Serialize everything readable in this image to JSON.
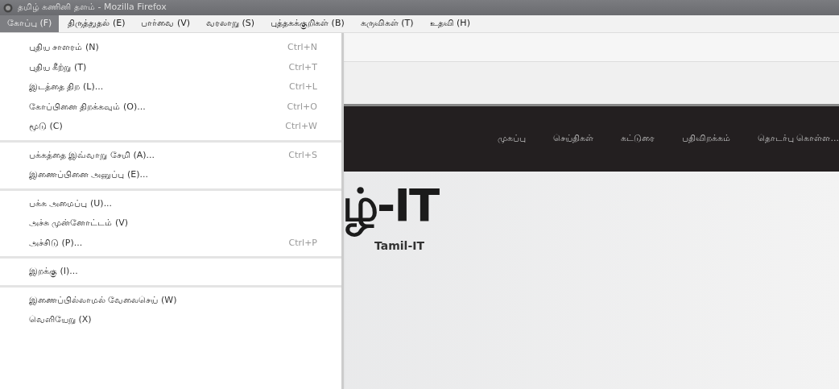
{
  "window": {
    "title": "தமிழ் கணினி தளம் - Mozilla Firefox"
  },
  "menu_bar": [
    {
      "label": "கோப்பு (F)",
      "selected": true
    },
    {
      "label": "திருத்துதல் (E)",
      "selected": false
    },
    {
      "label": "பார்வை (V)",
      "selected": false
    },
    {
      "label": "வரலாறு (S)",
      "selected": false
    },
    {
      "label": "புத்தகக்குறிகள் (B)",
      "selected": false
    },
    {
      "label": "கருவிகள் (T)",
      "selected": false
    },
    {
      "label": "உதவி (H)",
      "selected": false
    }
  ],
  "file_menu": {
    "groups": [
      [
        {
          "label": "புதிய சாளரம் (N)",
          "shortcut": "Ctrl+N"
        },
        {
          "label": "புதிய கீற்று (T)",
          "shortcut": "Ctrl+T"
        },
        {
          "label": "இடத்தை திற (L)...",
          "shortcut": "Ctrl+L"
        },
        {
          "label": "கோப்பினை திறக்கவும் (O)...",
          "shortcut": "Ctrl+O"
        },
        {
          "label": "மூடு (C)",
          "shortcut": "Ctrl+W"
        }
      ],
      [
        {
          "label": "பக்கத்தை இவ்வாறு சேமி (A)...",
          "shortcut": "Ctrl+S"
        },
        {
          "label": "இணைப்பினை அனுப்பு (E)..."
        }
      ],
      [
        {
          "label": "பக்க அமைப்பு (U)..."
        },
        {
          "label": "அச்சு முன்னோட்டம் (V)"
        },
        {
          "label": "அச்சிடு (P)...",
          "shortcut": "Ctrl+P"
        }
      ],
      [
        {
          "label": "இறக்கு (I)..."
        }
      ],
      [
        {
          "label": "இணைப்பில்லாமல் வேலைசெய் (W)"
        },
        {
          "label": "வெளியேறு (X)"
        }
      ]
    ]
  },
  "site": {
    "nav": [
      "முகப்பு",
      "செய்திகள்",
      "கட்டுரை",
      "பதிவிறக்கம்",
      "தொடர்பு கொள்ள..."
    ],
    "logo": "ழ்-IT",
    "logo_sub": "Tamil-IT"
  }
}
